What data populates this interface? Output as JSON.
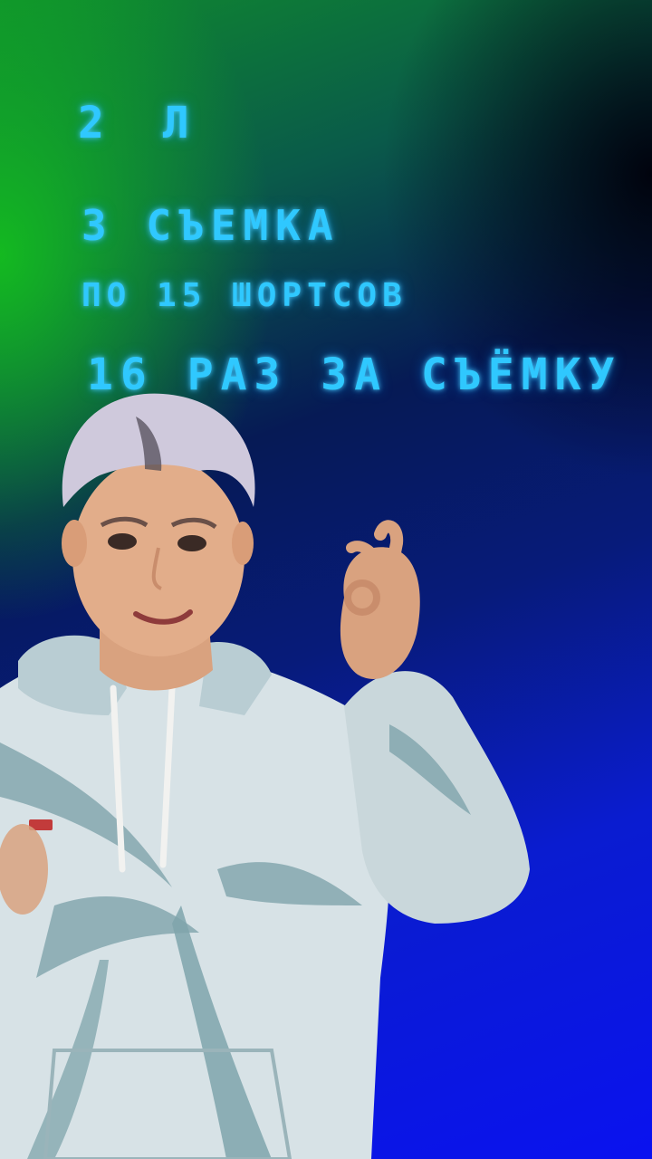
{
  "board": {
    "line1": "2 Л",
    "line2": "3 СЪЕМКА",
    "line3": "ПО 15 ШОРТСОВ",
    "line4": "16 РАЗ ЗА СЪЁМКУ"
  },
  "colors": {
    "marker_text": "#2fc8ff",
    "bg_green": "#14be1e",
    "bg_blue": "#0a12f0",
    "bg_dark": "#000010"
  },
  "scene": {
    "subject": "person-in-tie-dye-hoodie"
  }
}
